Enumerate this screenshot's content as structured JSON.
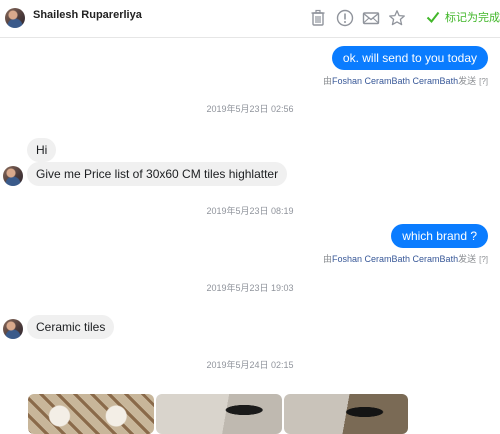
{
  "header": {
    "contact_name": "Shailesh Ruparerliya",
    "icons": [
      "trash-icon",
      "alert-icon",
      "envelope-icon",
      "star-icon",
      "checkmark-icon"
    ],
    "mark_done_label": "标记为完成",
    "mark_done_color": "#42b72a"
  },
  "messages": {
    "out1": {
      "text": "ok. will send to you today",
      "sent_prefix": "由",
      "sent_via": "Foshan CeramBath CeramBath",
      "sent_suffix": "发送",
      "help": "[?]"
    },
    "ts1": "2019年5月23日 02:56",
    "in1": "Hi",
    "in2": "Give me Price list of 30x60 CM tiles highlatter",
    "ts2": "2019年5月23日 08:19",
    "out2": {
      "text": "which brand ?",
      "sent_prefix": "由",
      "sent_via": "Foshan CeramBath CeramBath",
      "sent_suffix": "发送",
      "help": "[?]"
    },
    "ts3": "2019年5月23日 19:03",
    "in3": "Ceramic tiles",
    "ts4": "2019年5月24日 02:15"
  },
  "colors": {
    "outgoing_bubble": "#0a7cff",
    "incoming_bubble": "#f0f0f0",
    "timestamp": "#90949c"
  },
  "attachments": {
    "count_visible": 3
  }
}
